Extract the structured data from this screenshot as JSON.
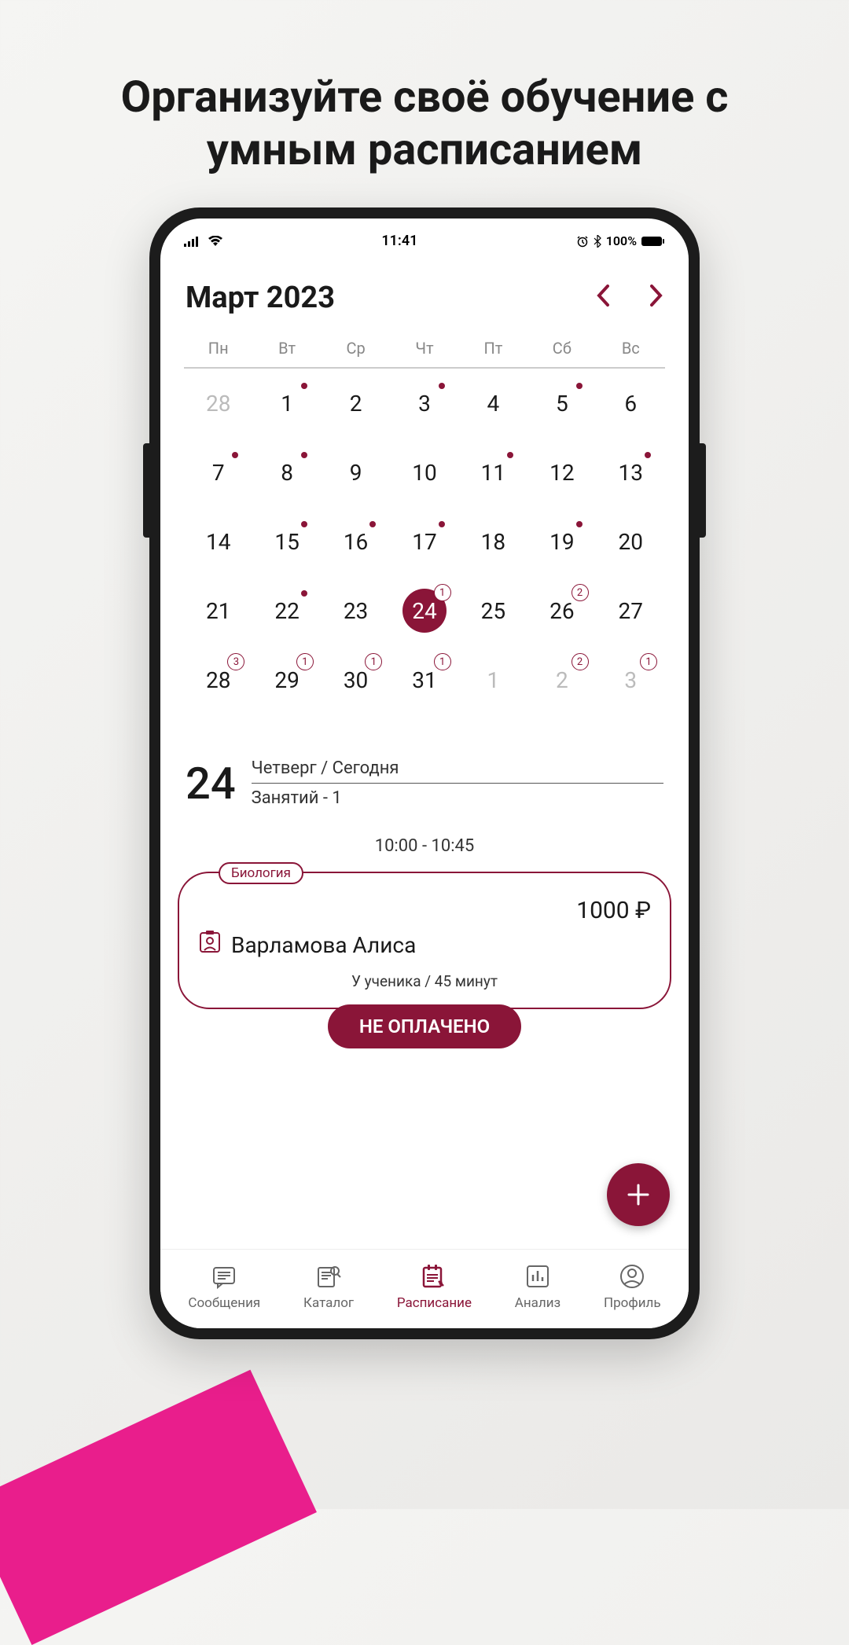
{
  "headline": "Организуйте своё обучение с умным расписанием",
  "status": {
    "time": "11:41",
    "battery": "100%"
  },
  "calendar": {
    "month_title": "Март 2023",
    "weekdays": [
      "Пн",
      "Вт",
      "Ср",
      "Чт",
      "Пт",
      "Сб",
      "Вс"
    ],
    "days": [
      {
        "n": "28",
        "dim": true
      },
      {
        "n": "1",
        "dot": true
      },
      {
        "n": "2"
      },
      {
        "n": "3",
        "dot": true
      },
      {
        "n": "4"
      },
      {
        "n": "5",
        "dot": true
      },
      {
        "n": "6"
      },
      {
        "n": "7",
        "dot": true
      },
      {
        "n": "8",
        "dot": true
      },
      {
        "n": "9"
      },
      {
        "n": "10"
      },
      {
        "n": "11",
        "dot": true
      },
      {
        "n": "12"
      },
      {
        "n": "13",
        "dot": true
      },
      {
        "n": "14"
      },
      {
        "n": "15",
        "dot": true
      },
      {
        "n": "16",
        "dot": true
      },
      {
        "n": "17",
        "dot": true
      },
      {
        "n": "18"
      },
      {
        "n": "19",
        "dot": true
      },
      {
        "n": "20"
      },
      {
        "n": "21"
      },
      {
        "n": "22",
        "dot": true
      },
      {
        "n": "23"
      },
      {
        "n": "24",
        "selected": true,
        "badge": "1"
      },
      {
        "n": "25"
      },
      {
        "n": "26",
        "badge": "2"
      },
      {
        "n": "27"
      },
      {
        "n": "28",
        "badge": "3"
      },
      {
        "n": "29",
        "badge": "1"
      },
      {
        "n": "30",
        "badge": "1"
      },
      {
        "n": "31",
        "badge": "1"
      },
      {
        "n": "1",
        "dim": true
      },
      {
        "n": "2",
        "dim": true,
        "badge": "2"
      },
      {
        "n": "3",
        "dim": true,
        "badge": "1"
      }
    ]
  },
  "day_detail": {
    "day_number": "24",
    "day_label": "Четверг / Сегодня",
    "lessons_count": "Занятий - 1"
  },
  "lesson": {
    "time": "10:00 - 10:45",
    "subject": "Биология",
    "price": "1000 ₽",
    "student": "Варламова Алиса",
    "meta": "У ученика / 45 минут",
    "unpaid": "НЕ ОПЛАЧЕНО"
  },
  "nav": {
    "messages": "Сообщения",
    "catalog": "Каталог",
    "schedule": "Расписание",
    "analysis": "Анализ",
    "profile": "Профиль"
  }
}
